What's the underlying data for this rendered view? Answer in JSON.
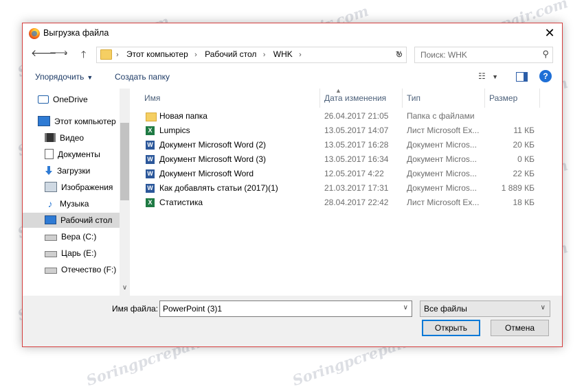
{
  "window": {
    "title": "Выгрузка файла",
    "close_glyph": "✕"
  },
  "address": {
    "crumbs": [
      "Этот компьютер",
      "Рабочий стол",
      "WHK"
    ],
    "search_placeholder": "Поиск: WHK"
  },
  "toolbar": {
    "organize": "Упорядочить",
    "new_folder": "Создать папку"
  },
  "nav": [
    {
      "label": "OneDrive",
      "icon": "onedrive-icon"
    },
    {
      "label": "Этот компьютер",
      "icon": "computer-icon"
    },
    {
      "label": "Видео",
      "icon": "video-icon"
    },
    {
      "label": "Документы",
      "icon": "documents-icon"
    },
    {
      "label": "Загрузки",
      "icon": "downloads-icon"
    },
    {
      "label": "Изображения",
      "icon": "images-icon"
    },
    {
      "label": "Музыка",
      "icon": "music-icon"
    },
    {
      "label": "Рабочий стол",
      "icon": "desktop-icon",
      "selected": true
    },
    {
      "label": "Вера (C:)",
      "icon": "drive-icon"
    },
    {
      "label": "Царь (E:)",
      "icon": "drive-icon"
    },
    {
      "label": "Отечество (F:)",
      "icon": "drive-icon"
    }
  ],
  "columns": {
    "name": "Имя",
    "date": "Дата изменения",
    "type": "Тип",
    "size": "Размер"
  },
  "files": [
    {
      "name": "Новая папка",
      "date": "26.04.2017 21:05",
      "type": "Папка с файлами",
      "size": "",
      "icon": "folder-icon"
    },
    {
      "name": "Lumpics",
      "date": "13.05.2017 14:07",
      "type": "Лист Microsoft Ex...",
      "size": "11 КБ",
      "icon": "excel-file-icon"
    },
    {
      "name": "Документ Microsoft Word (2)",
      "date": "13.05.2017 16:28",
      "type": "Документ Micros...",
      "size": "20 КБ",
      "icon": "word-file-icon"
    },
    {
      "name": "Документ Microsoft Word (3)",
      "date": "13.05.2017 16:34",
      "type": "Документ Micros...",
      "size": "0 КБ",
      "icon": "word-file-icon"
    },
    {
      "name": "Документ Microsoft Word",
      "date": "12.05.2017 4:22",
      "type": "Документ Micros...",
      "size": "22 КБ",
      "icon": "word-file-icon"
    },
    {
      "name": "Как добавлять статьи (2017)(1)",
      "date": "21.03.2017 17:31",
      "type": "Документ Micros...",
      "size": "1 889 КБ",
      "icon": "word-file-icon"
    },
    {
      "name": "Статистика",
      "date": "28.04.2017 22:42",
      "type": "Лист Microsoft Ex...",
      "size": "18 КБ",
      "icon": "excel-file-icon"
    }
  ],
  "bottom": {
    "filename_label": "Имя файла:",
    "filename_value": "PowerPoint (3)1",
    "filetype_value": "Все файлы",
    "open_button": "Открыть",
    "cancel_button": "Отмена"
  },
  "watermark": "Soringpcrepair.com",
  "colors": {
    "accent": "#0078d7",
    "border": "#d53d3d",
    "header_text": "#4c607a"
  }
}
